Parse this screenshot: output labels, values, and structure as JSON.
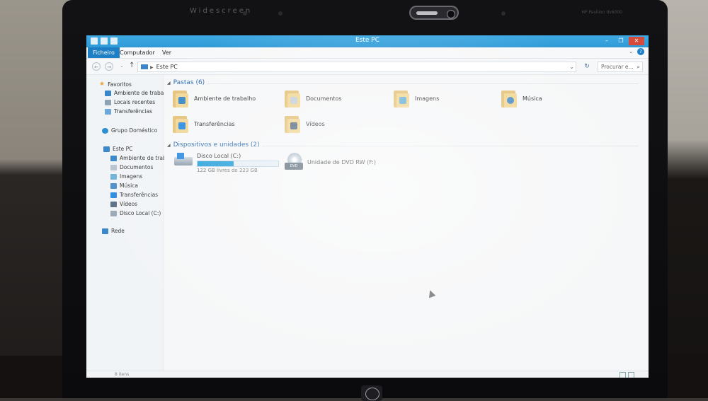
{
  "bezel": {
    "brand_text": "Widescreen",
    "brand_right": "HP Pavilion dv6000"
  },
  "window": {
    "title": "Este PC",
    "controls": {
      "minimize": "–",
      "maximize": "❐",
      "close": "✕"
    }
  },
  "menu": {
    "file": "Ficheiro",
    "computer": "Computador",
    "view": "Ver",
    "help": "?"
  },
  "address": {
    "back": "←",
    "forward": "→",
    "up": "↑",
    "path": "Este PC",
    "refresh": "↻",
    "search_placeholder": "Procurar e..."
  },
  "sidebar": {
    "favorites": {
      "label": "Favoritos",
      "items": [
        "Ambiente de trabalho",
        "Locais recentes",
        "Transferências"
      ]
    },
    "homegroup": "Grupo Doméstico",
    "thispc": {
      "label": "Este PC",
      "items": [
        "Ambiente de trabalh",
        "Documentos",
        "Imagens",
        "Música",
        "Transferências",
        "Vídeos",
        "Disco Local (C:)"
      ]
    },
    "network": "Rede"
  },
  "folders_group": {
    "header": "Pastas (6)",
    "items": [
      {
        "label": "Ambiente de trabalho",
        "icon": "desktop-folder-icon"
      },
      {
        "label": "Documentos",
        "icon": "documents-folder-icon"
      },
      {
        "label": "Imagens",
        "icon": "pictures-folder-icon"
      },
      {
        "label": "Música",
        "icon": "music-folder-icon"
      },
      {
        "label": "Transferências",
        "icon": "downloads-folder-icon"
      },
      {
        "label": "Vídeos",
        "icon": "videos-folder-icon"
      }
    ]
  },
  "devices_group": {
    "header": "Dispositivos e unidades (2)",
    "disk": {
      "label": "Disco Local (C:)",
      "free_text": "122 GB livres de 223 GB",
      "used_fraction": 0.45
    },
    "dvd": {
      "label": "Unidade de DVD RW (F:)",
      "badge": "DVD"
    }
  },
  "status": {
    "items": "8 itens"
  },
  "colors": {
    "accent": "#26a0da",
    "titlebar": "#3ea9e3",
    "close": "#d64b3c"
  }
}
